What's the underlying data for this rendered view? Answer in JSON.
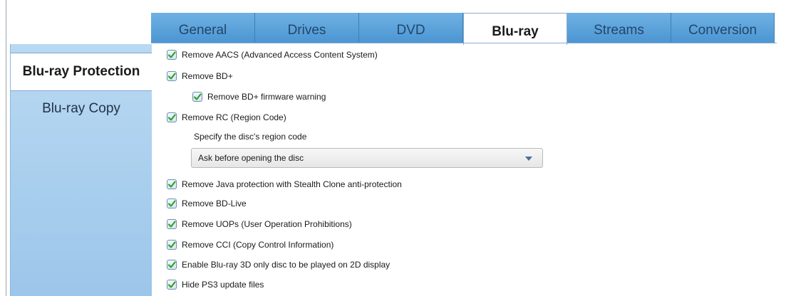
{
  "tabs": [
    {
      "label": "General"
    },
    {
      "label": "Drives"
    },
    {
      "label": "DVD"
    },
    {
      "label": "Blu-ray"
    },
    {
      "label": "Streams"
    },
    {
      "label": "Conversion"
    }
  ],
  "active_tab": "Blu-ray",
  "sidebar": {
    "items": [
      {
        "label": "Blu-ray Protection"
      },
      {
        "label": "Blu-ray Copy"
      }
    ],
    "active": "Blu-ray Protection"
  },
  "options": {
    "remove_aacs": {
      "label": "Remove AACS (Advanced Access Content System)",
      "checked": true
    },
    "remove_bdplus": {
      "label": "Remove BD+",
      "checked": true
    },
    "remove_bdplus_warning": {
      "label": "Remove BD+ firmware warning",
      "checked": true
    },
    "remove_rc": {
      "label": "Remove RC (Region Code)",
      "checked": true
    },
    "region_label": "Specify the disc's region code",
    "region_select": {
      "value": "Ask before opening the disc"
    },
    "remove_java": {
      "label": "Remove Java protection with Stealth Clone anti-protection",
      "checked": true
    },
    "remove_bdlive": {
      "label": "Remove BD-Live",
      "checked": true
    },
    "remove_uops": {
      "label": "Remove UOPs (User Operation Prohibitions)",
      "checked": true
    },
    "remove_cci": {
      "label": "Remove CCI (Copy Control Information)",
      "checked": true
    },
    "enable_3d": {
      "label": "Enable Blu-ray 3D only disc to be played on 2D display",
      "checked": true
    },
    "hide_ps3": {
      "label": "Hide PS3 update files",
      "checked": true
    }
  },
  "colors": {
    "tab_blue": "#5aa2dc",
    "sidebar_blue": "#aacfee",
    "check_green": "#2fa12a"
  }
}
